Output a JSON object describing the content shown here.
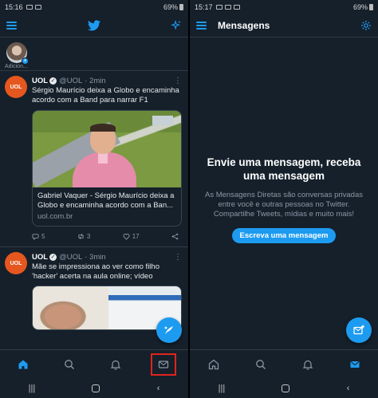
{
  "left": {
    "status": {
      "time": "15:16",
      "battery": "69%"
    },
    "story": {
      "label": "Adicion..."
    },
    "tweets": [
      {
        "avatar_text": "UOL",
        "name": "UOL",
        "handle": "@UOL",
        "time": "· 2min",
        "text": "Sérgio Maurício deixa a Globo e encaminha acordo com a Band para narrar F1",
        "card": {
          "title": "Gabriel Vaquer - Sérgio Maurício deixa a Globo e encaminha acordo com a Ban...",
          "domain": "uol.com.br"
        },
        "actions": {
          "replies": "5",
          "retweets": "3",
          "likes": "17"
        }
      },
      {
        "avatar_text": "UOL",
        "name": "UOL",
        "handle": "@UOL",
        "time": "· 3min",
        "text": "Mãe se impressiona ao ver como filho 'hacker' acerta na aula online; vídeo"
      }
    ]
  },
  "right": {
    "status": {
      "time": "15:17",
      "battery": "69%"
    },
    "title": "Mensagens",
    "empty": {
      "title": "Envie uma mensagem, receba uma mensagem",
      "description": "As Mensagens Diretas são conversas privadas entre você e outras pessoas no Twitter. Compartilhe Tweets, mídias e muito mais!",
      "button": "Escreva uma mensagem"
    }
  },
  "colors": {
    "accent": "#1d9bf0",
    "background": "#15202b",
    "highlight_box": "#e0241c",
    "uol": "#e5571e"
  },
  "icons": [
    "menu-icon",
    "twitter-bird-icon",
    "sparkle-icon",
    "settings-icon",
    "home-icon",
    "search-icon",
    "notifications-icon",
    "messages-icon",
    "compose-icon",
    "new-message-icon",
    "reply-icon",
    "retweet-icon",
    "like-icon",
    "share-icon"
  ]
}
